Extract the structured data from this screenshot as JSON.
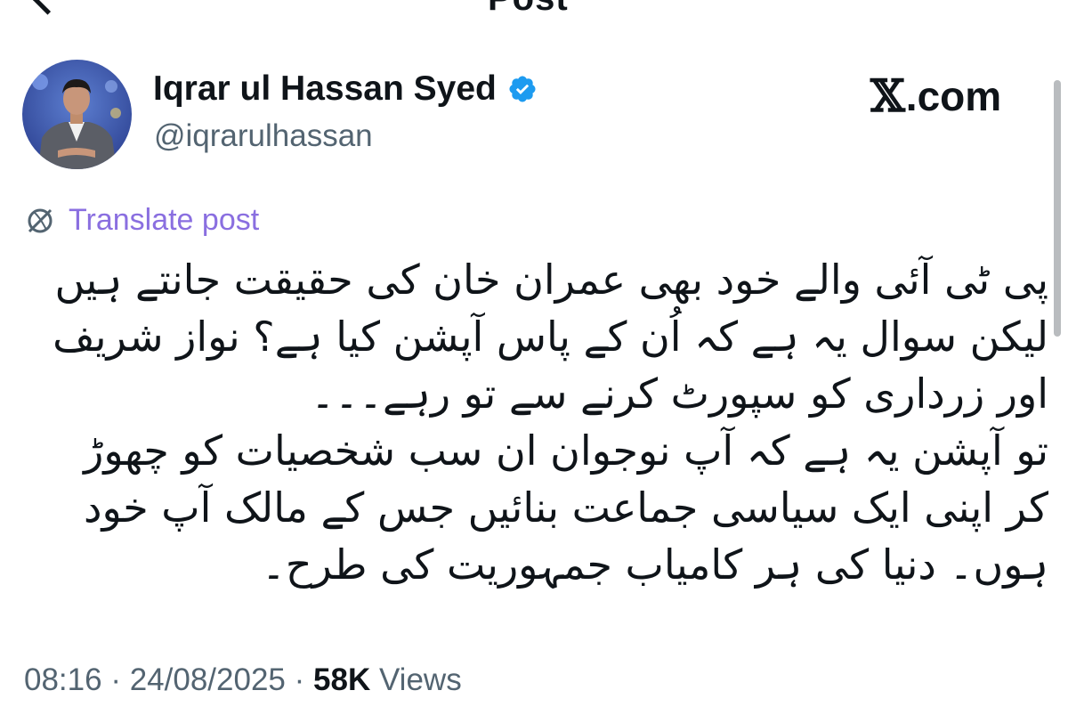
{
  "header": {
    "title": "Post"
  },
  "author": {
    "name": "Iqrar ul Hassan Syed",
    "handle": "@iqrarulhassan",
    "verified": true
  },
  "brand": {
    "label": ".com",
    "logo": "x-logo"
  },
  "translate": {
    "label": "Translate post",
    "icon": "translate-globe-icon"
  },
  "post": {
    "paragraphs": [
      "پی ٹی آئی والے خود بھی عمران خان کی حقیقت جانتے ہیں لیکن سوال یہ ہے کہ اُن کے پاس آپشن کیا ہے؟ نواز شریف اور زرداری کو سپورٹ کرنے سے تو رہے۔۔۔",
      "تو آپشن یہ ہے کہ آپ نوجوان ان سب شخصیات کو چھوڑ کر اپنی ایک سیاسی جماعت بنائیں جس کے مالک آپ خود ہوں۔ دنیا کی ہر کامیاب جمہوریت کی طرح۔"
    ]
  },
  "meta": {
    "time": "08:16",
    "separator": "·",
    "date": "24/08/2025",
    "views_count": "58K",
    "views_label": "Views"
  },
  "colors": {
    "text": "#0f1419",
    "muted": "#536471",
    "translate_link": "#8a6fe0",
    "verified_badge": "#1d9bf0"
  }
}
